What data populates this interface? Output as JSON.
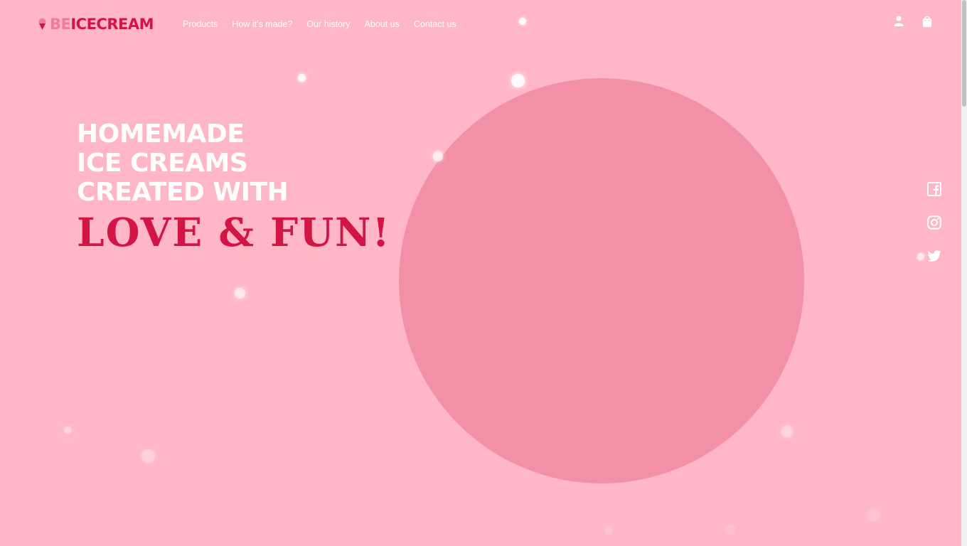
{
  "brand": {
    "part1": "BE",
    "part2": "ICECREAM"
  },
  "nav": {
    "items": [
      {
        "label": "Products"
      },
      {
        "label": "How it's made?"
      },
      {
        "label": "Our history"
      },
      {
        "label": "About us"
      },
      {
        "label": "Contact us"
      }
    ]
  },
  "header_icons": [
    "user-icon",
    "shopping-bag-icon"
  ],
  "hero": {
    "line1": "HOMEMADE",
    "line2": "ICE CREAMS",
    "line3": "CREATED WITH",
    "accent": "LOVE & FUN!"
  },
  "social": [
    "facebook-icon",
    "instagram-icon",
    "twitter-icon"
  ],
  "colors": {
    "background": "#ffb6c7",
    "circle": "#f291a5",
    "accent": "#d31546",
    "logo_light": "#f07c95",
    "text": "#ffffff"
  }
}
